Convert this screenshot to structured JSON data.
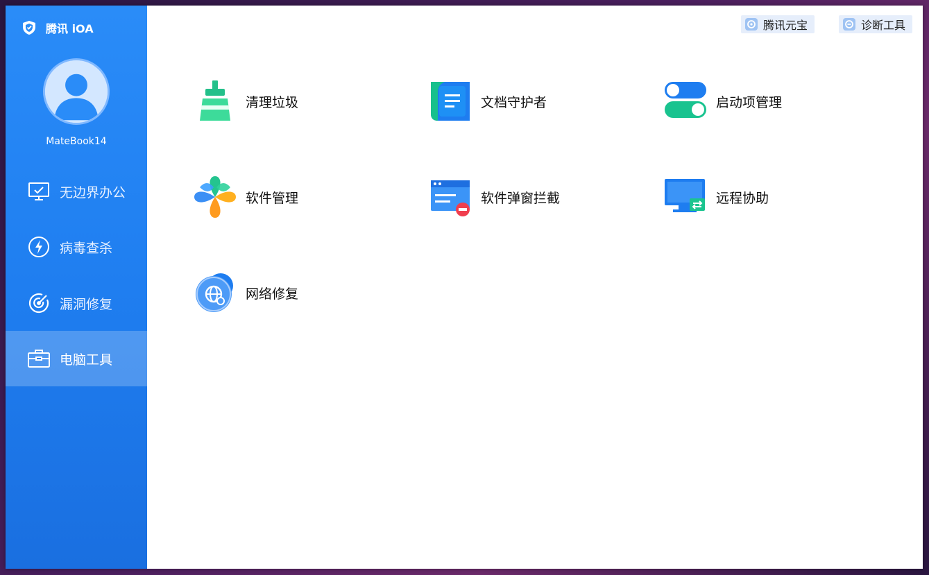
{
  "app": {
    "brand": "腾讯 iOA",
    "username": "MateBook14"
  },
  "sidebar": {
    "items": [
      {
        "label": "无边界办公",
        "icon": "monitor-icon"
      },
      {
        "label": "病毒查杀",
        "icon": "lightning-icon"
      },
      {
        "label": "漏洞修复",
        "icon": "target-icon"
      },
      {
        "label": "电脑工具",
        "icon": "toolbox-icon",
        "active": true
      }
    ]
  },
  "topbar": {
    "yuanbao": "腾讯元宝",
    "diagnose": "诊断工具"
  },
  "tools": [
    {
      "label": "清理垃圾",
      "icon": "broom-icon"
    },
    {
      "label": "文档守护者",
      "icon": "document-icon"
    },
    {
      "label": "启动项管理",
      "icon": "toggle-icon"
    },
    {
      "label": "软件管理",
      "icon": "clover-icon"
    },
    {
      "label": "软件弹窗拦截",
      "icon": "popup-block-icon"
    },
    {
      "label": "远程协助",
      "icon": "remote-monitor-icon"
    },
    {
      "label": "网络修复",
      "icon": "network-globe-icon"
    }
  ],
  "colors": {
    "sidebar": "#1f7ef0",
    "accent": "#2a8cf8",
    "active_item_bg": "rgba(255,255,255,0.22)"
  }
}
